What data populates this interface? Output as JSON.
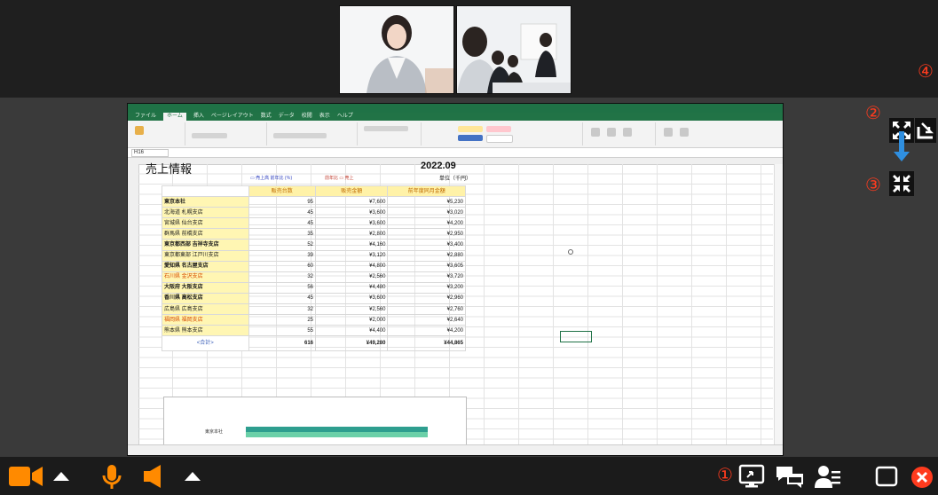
{
  "sheet": {
    "title": "売上情報",
    "date": "2022.09",
    "unit": "単位（千円）",
    "legend_left": "▭ 売上高  前年比 (％)",
    "legend_right": "前年比 ▭ 売上",
    "columns": [
      "販売台数",
      "販売金額",
      "前年度同月金額"
    ],
    "rows": [
      {
        "store": "東京本社",
        "units": "95",
        "amount": "¥7,600",
        "prev": "¥5,230",
        "style": "bold"
      },
      {
        "store": "北海道 札幌支店",
        "units": "45",
        "amount": "¥3,600",
        "prev": "¥3,020",
        "style": ""
      },
      {
        "store": "宮城県 仙台支店",
        "units": "45",
        "amount": "¥3,600",
        "prev": "¥4,200",
        "style": ""
      },
      {
        "store": "群馬県 前橋支店",
        "units": "35",
        "amount": "¥2,800",
        "prev": "¥2,950",
        "style": ""
      },
      {
        "store": "東京都西部 吉祥寺支店",
        "units": "52",
        "amount": "¥4,160",
        "prev": "¥3,400",
        "style": "bold"
      },
      {
        "store": "東京都東部 江戸川支店",
        "units": "39",
        "amount": "¥3,120",
        "prev": "¥2,880",
        "style": ""
      },
      {
        "store": "愛知県 名古屋支店",
        "units": "60",
        "amount": "¥4,800",
        "prev": "¥3,605",
        "style": "bold"
      },
      {
        "store": "石川県 金沢支店",
        "units": "32",
        "amount": "¥2,560",
        "prev": "¥3,720",
        "style": "red"
      },
      {
        "store": "大阪府 大阪支店",
        "units": "56",
        "amount": "¥4,480",
        "prev": "¥3,200",
        "style": "bold"
      },
      {
        "store": "香川県 高松支店",
        "units": "45",
        "amount": "¥3,600",
        "prev": "¥2,960",
        "style": "bold"
      },
      {
        "store": "広島県 広島支店",
        "units": "32",
        "amount": "¥2,560",
        "prev": "¥2,760",
        "style": ""
      },
      {
        "store": "福岡県 福岡支店",
        "units": "25",
        "amount": "¥2,000",
        "prev": "¥2,640",
        "style": "red"
      },
      {
        "store": "熊本県 熊本支店",
        "units": "55",
        "amount": "¥4,400",
        "prev": "¥4,200",
        "style": ""
      }
    ],
    "total": {
      "label": "<合計>",
      "units": "616",
      "amount": "¥49,280",
      "prev": "¥44,865"
    },
    "chart_label": "東京本社"
  },
  "excel": {
    "tabs": [
      "ファイル",
      "ホーム",
      "挿入",
      "ページレイアウト",
      "数式",
      "データ",
      "校閲",
      "表示",
      "ヘルプ"
    ],
    "active_tab": "ホーム",
    "namebox": "H16"
  },
  "annotations": {
    "num1": "①",
    "num2": "②",
    "num3": "③",
    "num4": "④"
  },
  "colors": {
    "accent_red": "#ff3b1e",
    "orange": "#ff8a00",
    "excel_green": "#217346",
    "arrow_blue": "#2f8fe0"
  },
  "icons": {
    "camera": "video-camera-icon",
    "mic": "microphone-icon",
    "speaker": "speaker-icon",
    "share": "screen-share-icon",
    "chat": "chat-icon",
    "participants": "participants-icon",
    "window": "window-icon",
    "close": "close-icon",
    "expand": "expand-icon",
    "collapse": "collapse-icon",
    "exit_fullscreen": "exit-fullscreen-icon"
  }
}
